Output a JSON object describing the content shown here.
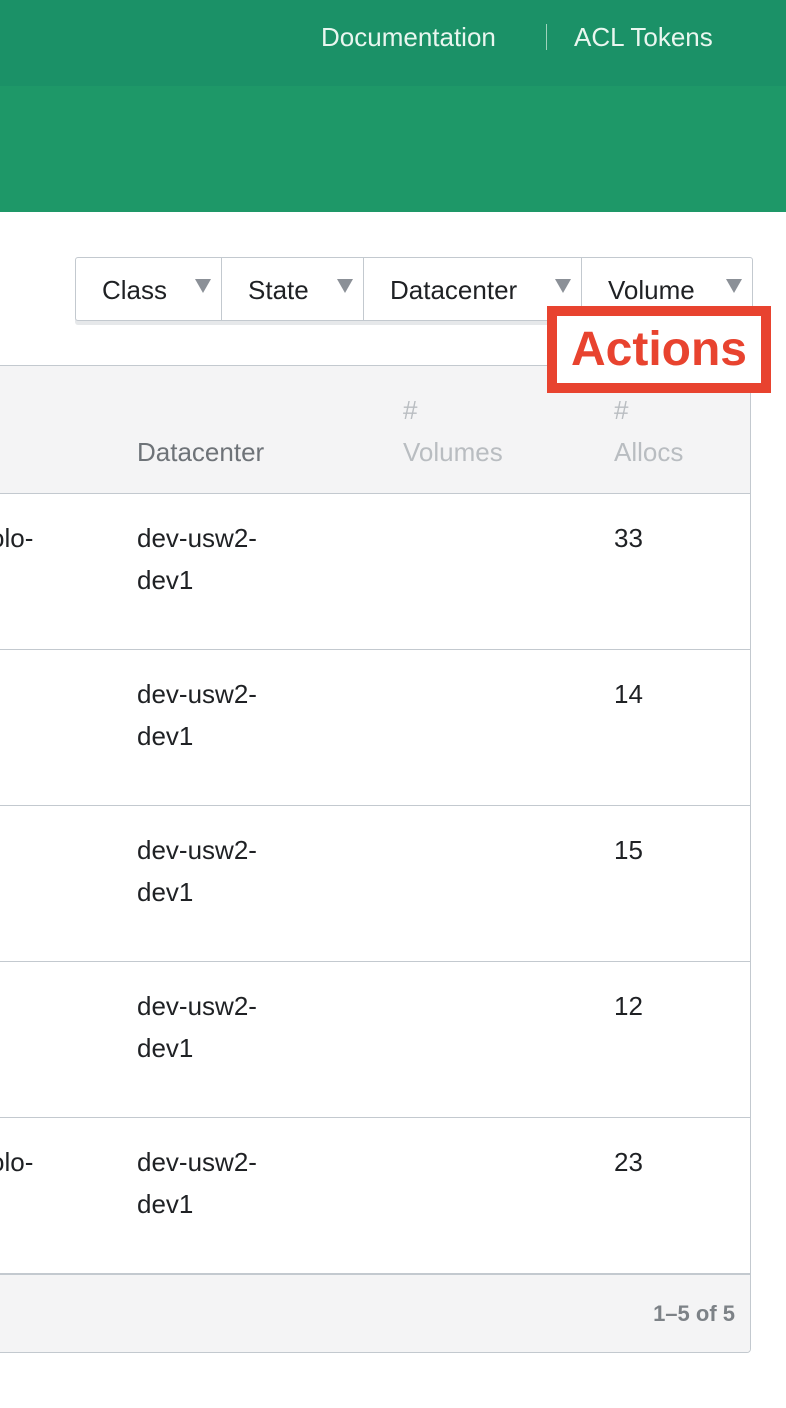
{
  "header": {
    "links": {
      "documentation": "Documentation",
      "acl_tokens": "ACL Tokens"
    },
    "brand_color": "#1e9868"
  },
  "facets": {
    "class": "Class",
    "state": "State",
    "datacenter": "Datacenter",
    "volume": "Volume"
  },
  "annotation": {
    "label": "Actions",
    "color": "#e8432f"
  },
  "table": {
    "columns": {
      "datacenter": "Datacenter",
      "volumes": "#\nVolumes",
      "allocs": "#\nAllocs"
    },
    "rows": [
      {
        "name_fragment": "olo-",
        "datacenter": "dev-usw2-\ndev1",
        "volumes": "",
        "allocs": "33"
      },
      {
        "name_fragment": "",
        "datacenter": "dev-usw2-\ndev1",
        "volumes": "",
        "allocs": "14"
      },
      {
        "name_fragment": "",
        "datacenter": "dev-usw2-\ndev1",
        "volumes": "",
        "allocs": "15"
      },
      {
        "name_fragment": "",
        "datacenter": "dev-usw2-\ndev1",
        "volumes": "",
        "allocs": "12"
      },
      {
        "name_fragment": "olo-",
        "datacenter": "dev-usw2-\ndev1",
        "volumes": "",
        "allocs": "23"
      }
    ],
    "pagination": "1–5 of 5"
  }
}
